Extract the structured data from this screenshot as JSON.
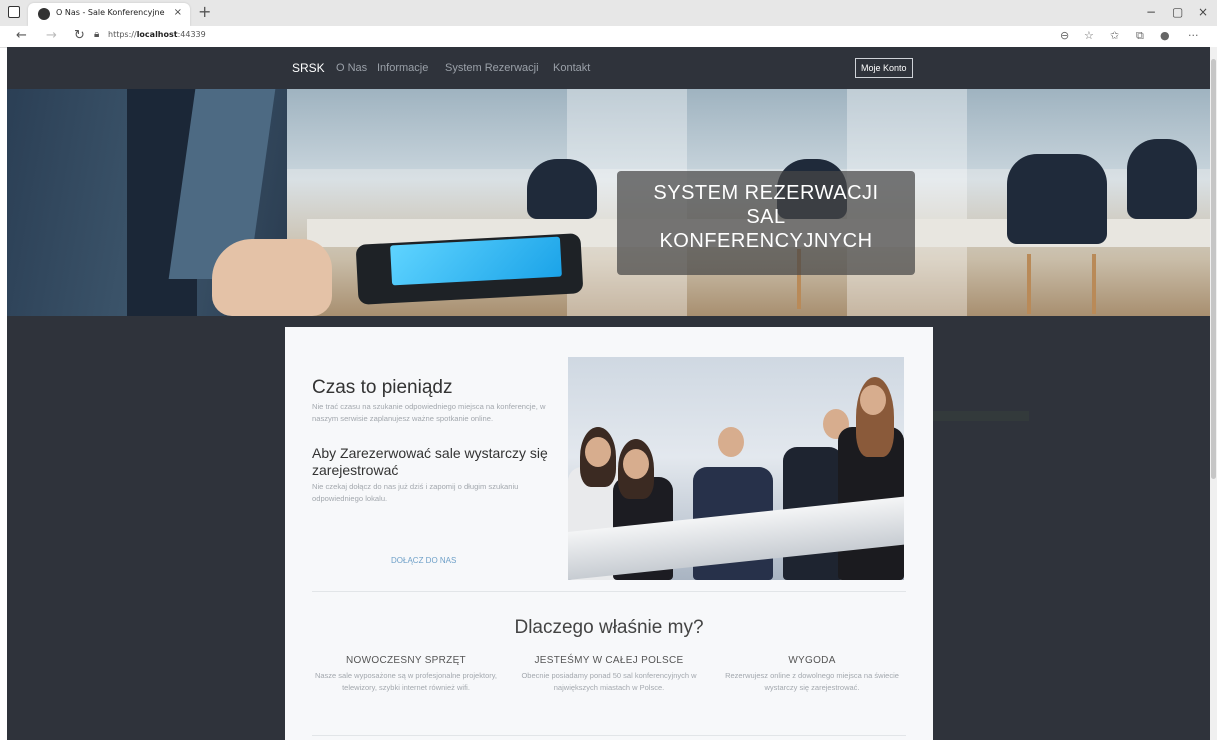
{
  "browser": {
    "tab_title": "O Nas - Sale Konferencyjne",
    "tab_close": "×",
    "new_tab": "+",
    "url_prefix": "https://",
    "url_host": "localhost",
    "url_port": ":44339",
    "window_controls": [
      "−",
      "▢",
      "×"
    ],
    "toolbar_more": "···"
  },
  "nav": {
    "brand": "SRSK",
    "links": [
      "O Nas",
      "Informacje",
      "System Rezerwacji",
      "Kontakt"
    ],
    "account": "Moje Konto"
  },
  "hero": {
    "caption_lines": [
      "SYSTEM REZERWACJI",
      "SAL",
      "KONFERENCYJNYCH"
    ]
  },
  "section1": {
    "heading": "Czas to pieniądz",
    "text": "Nie trać czasu na szukanie odpowiedniego miejsca na konferencje, w naszym serwisie zaplanujesz ważne spotkanie online.",
    "heading2": "Aby Zarezerwować sale wystarczy się zarejestrować",
    "text2": "Nie czekaj dołącz do nas już dziś i zapomij o długim szukaniu odpowiedniego lokalu.",
    "cta": "DOŁĄCZ DO NAS"
  },
  "why": {
    "heading": "Dlaczego właśnie my?",
    "features": [
      {
        "title": "NOWOCZESNY SPRZĘT",
        "text": "Nasze sale wyposażone są w profesjonalne projektory, telewizory, szybki internet również wifi."
      },
      {
        "title": "JESTEŚMY W CAŁEJ POLSCE",
        "text": "Obecnie posiadamy ponad 50 sal konferencyjnych w największych miastach w Polsce."
      },
      {
        "title": "WYGODA",
        "text": "Rezerwujesz online z dowolnego miejsca na świecie wystarczy się zarejestrować."
      }
    ]
  }
}
